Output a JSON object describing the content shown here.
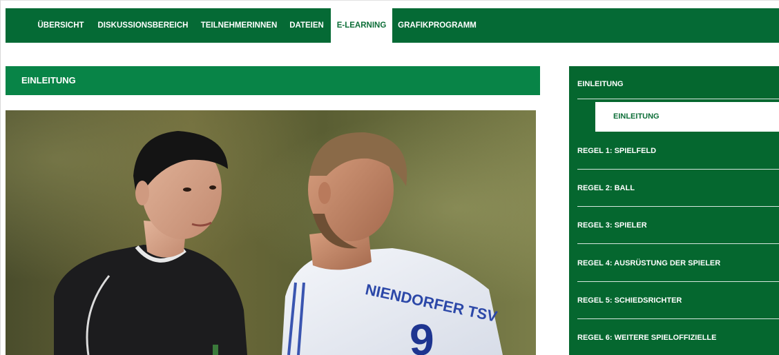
{
  "nav": {
    "items": [
      {
        "label": "ÜBERSICHT",
        "active": false
      },
      {
        "label": "DISKUSSIONSBEREICH",
        "active": false
      },
      {
        "label": "TEILNEHMERINNEN",
        "active": false
      },
      {
        "label": "DATEIEN",
        "active": false
      },
      {
        "label": "E-LEARNING",
        "active": true
      },
      {
        "label": "GRAFIKPROGRAMM",
        "active": false
      }
    ]
  },
  "main": {
    "heading": "EINLEITUNG",
    "image": {
      "subject": "referee-talking-with-player",
      "jersey_text": "NIENDORFER TSV",
      "jersey_number": "9"
    }
  },
  "sidebar": {
    "section_title": "EINLEITUNG",
    "active_sub_item": "EINLEITUNG",
    "items": [
      {
        "label": "REGEL 1: SPIELFELD"
      },
      {
        "label": "REGEL 2: BALL"
      },
      {
        "label": "REGEL 3: SPIELER"
      },
      {
        "label": "REGEL 4: AUSRÜSTUNG DER SPIELER"
      },
      {
        "label": "REGEL 5: SCHIEDSRICHTER"
      },
      {
        "label": "REGEL 6: WEITERE SPIELOFFIZIELLE"
      }
    ]
  },
  "colors": {
    "primary_green": "#056a35",
    "heading_green": "#088447",
    "active_text": "#0d6e38",
    "white": "#ffffff"
  }
}
